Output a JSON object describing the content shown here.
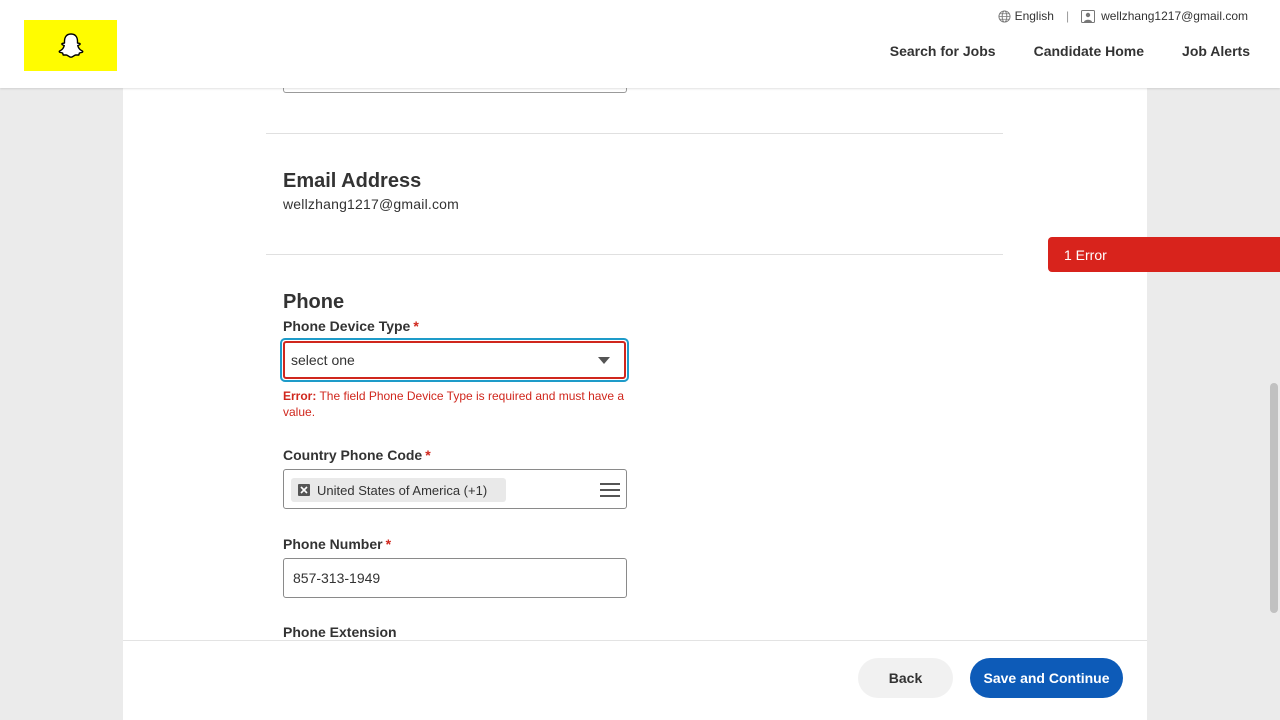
{
  "header": {
    "language": "English",
    "user_email": "wellzhang1217@gmail.com",
    "separator": "|",
    "nav": {
      "search_jobs": "Search for Jobs",
      "candidate_home": "Candidate Home",
      "job_alerts": "Job Alerts"
    }
  },
  "email_section": {
    "title": "Email Address",
    "value": "wellzhang1217@gmail.com"
  },
  "phone_section": {
    "title": "Phone",
    "device_type": {
      "label": "Phone Device Type",
      "required_mark": "*",
      "value": "select one",
      "error_prefix": "Error:",
      "error_text": "The field Phone Device Type is required and must have a value."
    },
    "country_code": {
      "label": "Country Phone Code",
      "required_mark": "*",
      "selected": "United States of America (+1)"
    },
    "phone_number": {
      "label": "Phone Number",
      "required_mark": "*",
      "value": "857-313-1949"
    },
    "extension": {
      "label": "Phone Extension"
    }
  },
  "error_banner": {
    "text": "1 Error"
  },
  "footer": {
    "back_label": "Back",
    "save_label": "Save and Continue"
  },
  "colors": {
    "brand_yellow": "#fffc00",
    "primary_blue": "#0d5bb8",
    "error_red": "#d8231c",
    "focus_ring": "#1e9bc9"
  }
}
